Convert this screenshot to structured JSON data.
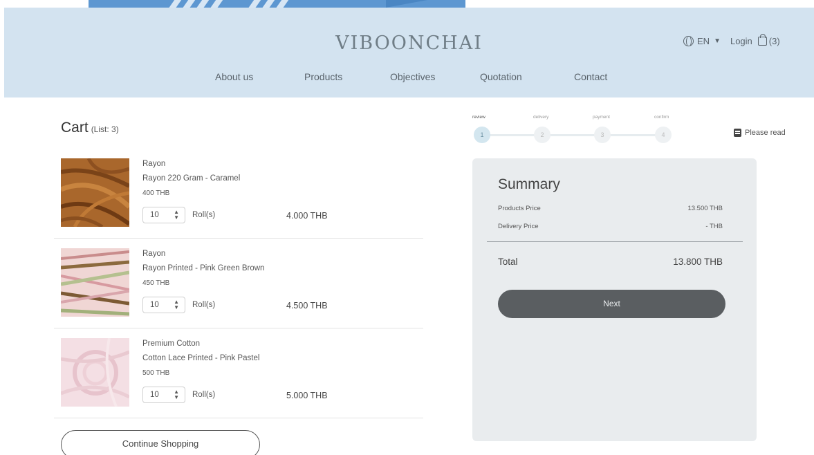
{
  "brand": {
    "name": "VIBOONCHAI"
  },
  "nav": [
    "About us",
    "Products",
    "Objectives",
    "Quotation",
    "Contact"
  ],
  "util": {
    "language": "EN",
    "login": "Login",
    "cart_count": "(3)"
  },
  "cart": {
    "title": "Cart",
    "count_label": "(List: 3)",
    "items": [
      {
        "category": "Rayon",
        "name": "Rayon 220 Gram - Caramel",
        "unit_price": "400 THB",
        "qty": "10",
        "unit": "Roll(s)",
        "total": "4.000 THB"
      },
      {
        "category": "Rayon",
        "name": "Rayon Printed - Pink Green Brown",
        "unit_price": "450 THB",
        "qty": "10",
        "unit": "Roll(s)",
        "total": "4.500 THB"
      },
      {
        "category": "Premium Cotton",
        "name": "Cotton Lace Printed - Pink Pastel",
        "unit_price": "500 THB",
        "qty": "10",
        "unit": "Roll(s)",
        "total": "5.000 THB"
      }
    ],
    "continue_label": "Continue Shopping"
  },
  "steps": [
    {
      "label": "review",
      "number": "1",
      "active": true
    },
    {
      "label": "delivery",
      "number": "2",
      "active": false
    },
    {
      "label": "payment",
      "number": "3",
      "active": false
    },
    {
      "label": "confirm",
      "number": "4",
      "active": false
    }
  ],
  "please_read": "Please read",
  "summary": {
    "title": "Summary",
    "products_label": "Products Price",
    "products_value": "13.500 THB",
    "delivery_label": "Delivery Price",
    "delivery_value": "- THB",
    "total_label": "Total",
    "total_value": "13.800 THB",
    "next_label": "Next"
  },
  "colors": {
    "header_bg": "#d3e3f0",
    "summary_bg": "#e9ecee",
    "button_dark": "#5a5e61",
    "step_active": "#d3e6ef"
  }
}
